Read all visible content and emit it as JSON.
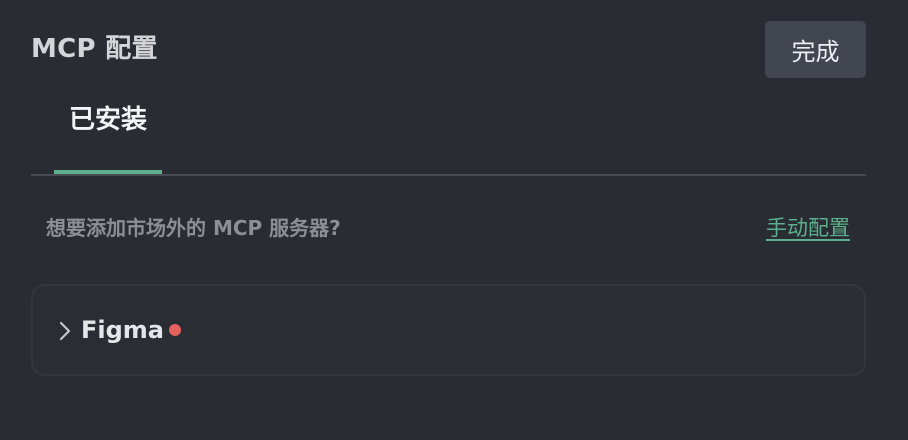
{
  "header": {
    "title": "MCP 配置",
    "done_label": "完成"
  },
  "tabs": [
    {
      "label": "已安装",
      "active": true
    }
  ],
  "hint": {
    "text": "想要添加市场外的 MCP 服务器?",
    "link_label": "手动配置"
  },
  "servers": [
    {
      "name": "Figma",
      "status": "error",
      "status_color": "#e5615d",
      "expanded": false,
      "icon": "chevron-right-icon"
    }
  ],
  "colors": {
    "background": "#292c33",
    "accent": "#5cb08e",
    "button_bg": "#414651"
  }
}
